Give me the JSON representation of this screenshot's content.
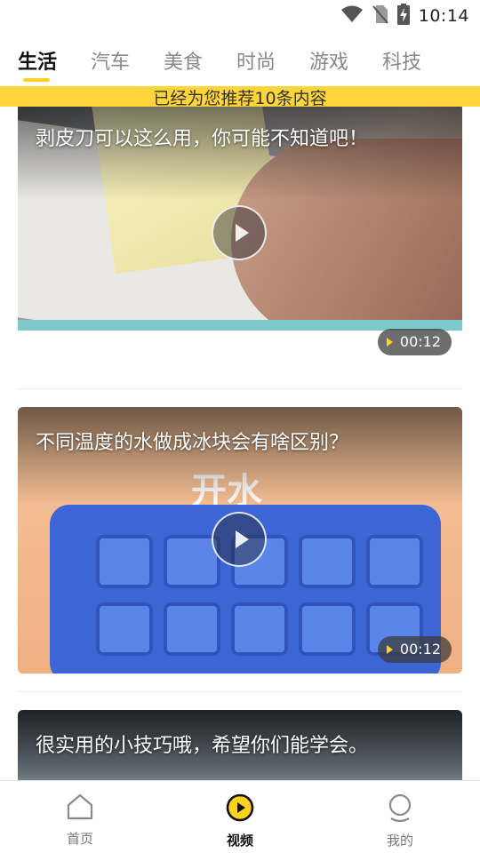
{
  "status_bar": {
    "time": "10:14",
    "icons": [
      "wifi-icon",
      "no-sim-icon",
      "battery-charging-icon"
    ]
  },
  "tabs": [
    {
      "label": "生活",
      "active": true
    },
    {
      "label": "汽车",
      "active": false
    },
    {
      "label": "美食",
      "active": false
    },
    {
      "label": "时尚",
      "active": false
    },
    {
      "label": "游戏",
      "active": false
    },
    {
      "label": "科技",
      "active": false
    }
  ],
  "toast": {
    "text": "已经为您推荐10条内容"
  },
  "videos": [
    {
      "title": "剥皮刀可以这么用，你可能不知道吧！",
      "duration": "00:12"
    },
    {
      "title": "不同温度的水做成冰块会有啥区别？",
      "duration": "00:12",
      "caption": "开水"
    },
    {
      "title": "很实用的小技巧哦，希望你们能学会。"
    }
  ],
  "bottom_nav": [
    {
      "label": "首页",
      "icon": "home-icon",
      "active": false
    },
    {
      "label": "视频",
      "icon": "video-play-icon",
      "active": true
    },
    {
      "label": "我的",
      "icon": "profile-icon",
      "active": false
    }
  ],
  "colors": {
    "accent": "#ffd21e",
    "toast_bg": "#ffd53a"
  }
}
